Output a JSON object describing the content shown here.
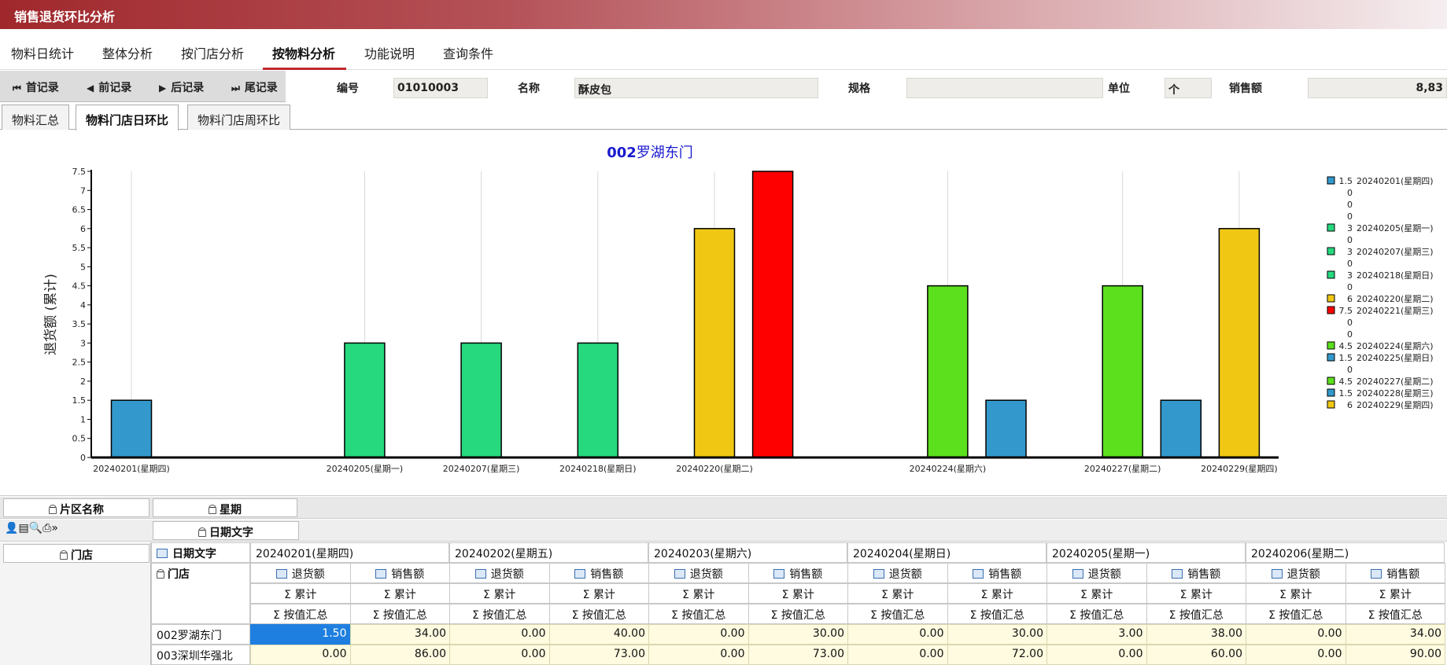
{
  "window": {
    "title": "销售退货环比分析"
  },
  "menu": {
    "items": [
      "物料日统计",
      "整体分析",
      "按门店分析",
      "按物料分析",
      "功能说明",
      "查询条件"
    ],
    "active_index": 3
  },
  "nav": {
    "first": "首记录",
    "prev": "前记录",
    "next": "后记录",
    "last": "尾记录"
  },
  "fields": {
    "code_label": "编号",
    "code_value": "01010003",
    "name_label": "名称",
    "name_value": "酥皮包",
    "spec_label": "规格",
    "spec_value": "",
    "unit_label": "单位",
    "unit_value": "个",
    "sales_label": "销售额",
    "sales_value": "8,83"
  },
  "subtabs": {
    "items": [
      "物料汇总",
      "物料门店日环比",
      "物料门店周环比"
    ],
    "active_index": 1
  },
  "chart_data": {
    "type": "bar",
    "title_bold": "002",
    "title_rest": "罗湖东门",
    "ylabel": "退货额 (累计)",
    "ylim": [
      0,
      7.5
    ],
    "yticks": [
      "0",
      "0.5",
      "1",
      "1.5",
      "2",
      "2.5",
      "3",
      "3.5",
      "4",
      "4.5",
      "5",
      "5.5",
      "6",
      "6.5",
      "7",
      "7.5"
    ],
    "xticks": [
      {
        "label": "20240201(星期四)",
        "slot": 0
      },
      {
        "label": "20240205(星期一)",
        "slot": 4
      },
      {
        "label": "20240207(星期三)",
        "slot": 6
      },
      {
        "label": "20240218(星期日)",
        "slot": 8
      },
      {
        "label": "20240220(星期二)",
        "slot": 10
      },
      {
        "label": "20240224(星期六)",
        "slot": 14
      },
      {
        "label": "20240227(星期二)",
        "slot": 17
      },
      {
        "label": "20240229(星期四)",
        "slot": 19
      }
    ],
    "bars": [
      {
        "slot": 0,
        "value": 1.5,
        "color": "#3399cc"
      },
      {
        "slot": 4,
        "value": 3,
        "color": "#26d97f"
      },
      {
        "slot": 6,
        "value": 3,
        "color": "#26d97f"
      },
      {
        "slot": 8,
        "value": 3,
        "color": "#26d97f"
      },
      {
        "slot": 10,
        "value": 6,
        "color": "#f0c814"
      },
      {
        "slot": 11,
        "value": 7.5,
        "color": "#ff0000"
      },
      {
        "slot": 14,
        "value": 4.5,
        "color": "#5ce01e"
      },
      {
        "slot": 15,
        "value": 1.5,
        "color": "#3399cc"
      },
      {
        "slot": 17,
        "value": 4.5,
        "color": "#5ce01e"
      },
      {
        "slot": 18,
        "value": 1.5,
        "color": "#3399cc"
      },
      {
        "slot": 19,
        "value": 6,
        "color": "#f0c814"
      }
    ],
    "legend": [
      {
        "value": "1.5",
        "label": "20240201(星期四)",
        "color": "#3399cc"
      },
      {
        "value": "0",
        "label": "",
        "color": ""
      },
      {
        "value": "0",
        "label": "",
        "color": ""
      },
      {
        "value": "0",
        "label": "",
        "color": ""
      },
      {
        "value": "3",
        "label": "20240205(星期一)",
        "color": "#26d97f"
      },
      {
        "value": "0",
        "label": "",
        "color": ""
      },
      {
        "value": "3",
        "label": "20240207(星期三)",
        "color": "#26d97f"
      },
      {
        "value": "0",
        "label": "",
        "color": ""
      },
      {
        "value": "3",
        "label": "20240218(星期日)",
        "color": "#26d97f"
      },
      {
        "value": "0",
        "label": "",
        "color": ""
      },
      {
        "value": "6",
        "label": "20240220(星期二)",
        "color": "#f0c814"
      },
      {
        "value": "7.5",
        "label": "20240221(星期三)",
        "color": "#ff0000"
      },
      {
        "value": "0",
        "label": "",
        "color": ""
      },
      {
        "value": "0",
        "label": "",
        "color": ""
      },
      {
        "value": "4.5",
        "label": "20240224(星期六)",
        "color": "#5ce01e"
      },
      {
        "value": "1.5",
        "label": "20240225(星期日)",
        "color": "#3399cc"
      },
      {
        "value": "0",
        "label": "",
        "color": ""
      },
      {
        "value": "4.5",
        "label": "20240227(星期二)",
        "color": "#5ce01e"
      },
      {
        "value": "1.5",
        "label": "20240228(星期三)",
        "color": "#3399cc"
      },
      {
        "value": "6",
        "label": "20240229(星期四)",
        "color": "#f0c814"
      }
    ]
  },
  "pivot": {
    "filter_area": "片区名称",
    "filter_week": "星期",
    "col_field": "日期文字",
    "row_field": "门店",
    "date_text_field": "日期文字",
    "store_field": "门店",
    "dates": [
      "20240201(星期四)",
      "20240202(星期五)",
      "20240203(星期六)",
      "20240204(星期日)",
      "20240205(星期一)",
      "20240206(星期二)"
    ],
    "measures": [
      "退货额",
      "销售额"
    ],
    "agg": "Σ 累计",
    "agg2": "Σ 按值汇总",
    "rows": [
      {
        "store": "002罗湖东门",
        "values": [
          "1.50",
          "34.00",
          "0.00",
          "40.00",
          "0.00",
          "30.00",
          "0.00",
          "30.00",
          "3.00",
          "38.00",
          "0.00",
          "34.00"
        ]
      },
      {
        "store": "003深圳华强北",
        "values": [
          "0.00",
          "86.00",
          "0.00",
          "73.00",
          "0.00",
          "73.00",
          "0.00",
          "72.00",
          "0.00",
          "60.00",
          "0.00",
          "90.00"
        ]
      }
    ]
  }
}
